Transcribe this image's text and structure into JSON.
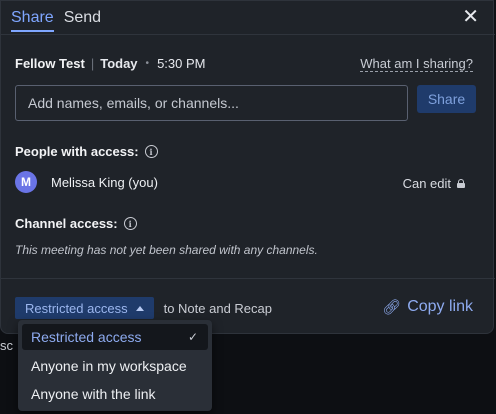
{
  "tabs": [
    {
      "label": "Share",
      "active": true
    },
    {
      "label": "Send",
      "active": false
    }
  ],
  "meeting": {
    "title": "Fellow Test",
    "day": "Today",
    "time": "5:30 PM"
  },
  "what_sharing_link": "What am I sharing?",
  "invite": {
    "placeholder": "Add names, emails, or channels...",
    "value": "",
    "share_label": "Share"
  },
  "people_section": {
    "title": "People with access:",
    "people": [
      {
        "initial": "M",
        "name": "Melissa King (you)",
        "permission": "Can edit"
      }
    ]
  },
  "channel_section": {
    "title": "Channel access:",
    "empty_note": "This meeting has not yet been shared with any channels."
  },
  "access": {
    "selected": "Restricted access",
    "suffix": "to Note and Recap",
    "copy_link_label": "Copy link",
    "options": [
      {
        "label": "Restricted access",
        "selected": true
      },
      {
        "label": "Anyone in my workspace",
        "selected": false
      },
      {
        "label": "Anyone with the link",
        "selected": false
      }
    ]
  },
  "background_peek_text": "sc",
  "colors": {
    "accent": "#7fa6ff",
    "dialog_bg": "#1f2329",
    "avatar": "#6a74e6",
    "select_bg": "#1f3b6b"
  },
  "icons": {
    "close": "close-icon",
    "info": "info-icon",
    "lock": "lock-icon",
    "link": "link-icon",
    "caret": "caret-up-icon",
    "check": "check-icon"
  }
}
